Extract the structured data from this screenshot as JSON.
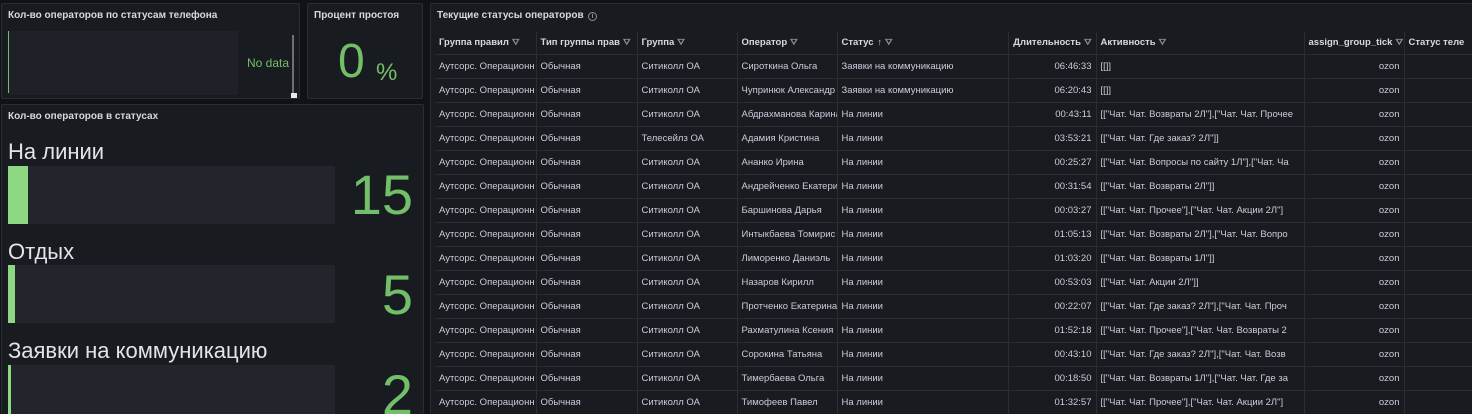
{
  "panels": {
    "phone_status": {
      "title": "Кол-во операторов по статусам телефона",
      "empty_text": "No data"
    },
    "idle_percent": {
      "title": "Процент простоя",
      "value": "0",
      "unit": "%"
    },
    "operators_in_statuses": {
      "title": "Кол-во операторов в статусах",
      "items": [
        {
          "label": "На линии",
          "value": "15",
          "fill_fraction": 0.06
        },
        {
          "label": "Отдых",
          "value": "5",
          "fill_fraction": 0.02
        },
        {
          "label": "Заявки на коммуникацию",
          "value": "2",
          "fill_fraction": 0.01
        }
      ]
    },
    "current_statuses": {
      "title": "Текущие статусы операторов",
      "columns": [
        "Группа правил",
        "Тип группы прав",
        "Группа",
        "Оператор",
        "Статус",
        "Длительность",
        "Активность",
        "assign_group_tick",
        "Статус теле"
      ],
      "rows": [
        [
          "Аутсорс. Операционн",
          "Обычная",
          "Ситиколл ОА",
          "Сироткина Ольга",
          "Заявки на коммуникацию",
          "06:46:33",
          "[[]]",
          "ozon",
          ""
        ],
        [
          "Аутсорс. Операционн",
          "Обычная",
          "Ситиколл ОА",
          "Чупринюк Александр",
          "Заявки на коммуникацию",
          "06:20:43",
          "[[]]",
          "ozon",
          ""
        ],
        [
          "Аутсорс. Операционн",
          "Обычная",
          "Ситиколл ОА",
          "Абдрахманова Карина",
          "На линии",
          "00:43:11",
          "[[\"Чат. Чат. Возвраты 2Л\"],[\"Чат. Чат. Прочее",
          "ozon",
          ""
        ],
        [
          "Аутсорс. Операционн",
          "Обычная",
          "Телесейлз ОА",
          "Адамия Кристина",
          "На линии",
          "03:53:21",
          "[[\"Чат. Чат. Где заказ? 2Л\"]]",
          "ozon",
          ""
        ],
        [
          "Аутсорс. Операционн",
          "Обычная",
          "Ситиколл ОА",
          "Ананко Ирина",
          "На линии",
          "00:25:27",
          "[[\"Чат. Чат. Вопросы по сайту 1Л\"],[\"Чат. Ча",
          "ozon",
          ""
        ],
        [
          "Аутсорс. Операционн",
          "Обычная",
          "Ситиколл ОА",
          "Андрейченко Екатери",
          "На линии",
          "00:31:54",
          "[[\"Чат. Чат. Возвраты 2Л\"]]",
          "ozon",
          ""
        ],
        [
          "Аутсорс. Операционн",
          "Обычная",
          "Ситиколл ОА",
          "Баршинова Дарья",
          "На линии",
          "00:03:27",
          "[[\"Чат. Чат. Прочее\"],[\"Чат. Чат. Акции 2Л\"]",
          "ozon",
          ""
        ],
        [
          "Аутсорс. Операционн",
          "Обычная",
          "Ситиколл ОА",
          "Интыкбаева Томирис",
          "На линии",
          "01:05:13",
          "[[\"Чат. Чат. Возвраты 2Л\"],[\"Чат. Чат. Вопро",
          "ozon",
          ""
        ],
        [
          "Аутсорс. Операционн",
          "Обычная",
          "Ситиколл ОА",
          "Лиморенко Даниэль",
          "На линии",
          "01:03:20",
          "[[\"Чат. Чат. Возвраты 1Л\"]]",
          "ozon",
          ""
        ],
        [
          "Аутсорс. Операционн",
          "Обычная",
          "Ситиколл ОА",
          "Назаров Кирилл",
          "На линии",
          "00:53:03",
          "[[\"Чат. Чат. Акции 2Л\"]]",
          "ozon",
          ""
        ],
        [
          "Аутсорс. Операционн",
          "Обычная",
          "Ситиколл ОА",
          "Протченко Екатерина",
          "На линии",
          "00:22:07",
          "[[\"Чат. Чат. Где заказ? 2Л\"],[\"Чат. Чат. Проч",
          "ozon",
          ""
        ],
        [
          "Аутсорс. Операционн",
          "Обычная",
          "Ситиколл ОА",
          "Рахматулина Ксения",
          "На линии",
          "01:52:18",
          "[[\"Чат. Чат. Прочее\"],[\"Чат. Чат. Возвраты 2",
          "ozon",
          ""
        ],
        [
          "Аутсорс. Операционн",
          "Обычная",
          "Ситиколл ОА",
          "Сорокина Татьяна",
          "На линии",
          "00:43:10",
          "[[\"Чат. Чат. Где заказ? 2Л\"],[\"Чат. Чат. Возв",
          "ozon",
          ""
        ],
        [
          "Аутсорс. Операционн",
          "Обычная",
          "Ситиколл ОА",
          "Тимербаева Ольга",
          "На линии",
          "00:18:50",
          "[[\"Чат. Чат. Возвраты 1Л\"],[\"Чат. Чат. Где за",
          "ozon",
          ""
        ],
        [
          "Аутсорс. Операционн",
          "Обычная",
          "Ситиколл ОА",
          "Тимофеев Павел",
          "На линии",
          "01:32:57",
          "[[\"Чат. Чат. Прочее\"],[\"Чат. Чат. Акции 2Л\"]",
          "ozon",
          ""
        ]
      ]
    }
  },
  "colors": {
    "accent_green": "#73bf69",
    "bar_fill": "#8ed883",
    "panel_bg": "#181b1f",
    "page_bg": "#111217"
  },
  "icons": {
    "filter": "filter-icon",
    "sort": "sort-ascending-icon",
    "info": "info-icon"
  }
}
